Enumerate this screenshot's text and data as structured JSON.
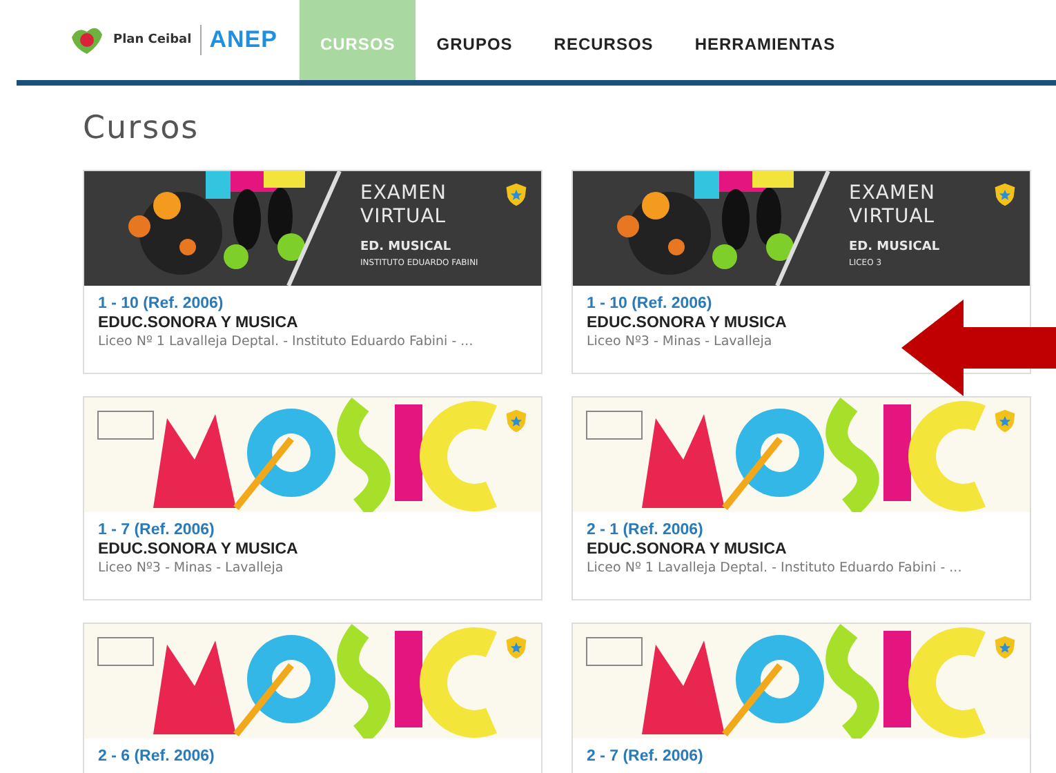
{
  "header": {
    "brand": "Plan Ceibal",
    "logo_text": "ANEP",
    "nav": [
      {
        "label": "CURSOS",
        "selected": true
      },
      {
        "label": "GRUPOS",
        "selected": false
      },
      {
        "label": "RECURSOS",
        "selected": false
      },
      {
        "label": "HERRAMIENTAS",
        "selected": false
      }
    ]
  },
  "page_title": "Cursos",
  "cards": [
    {
      "banner": {
        "kind": "exam",
        "heading": "EXAMEN VIRTUAL",
        "subject": "ED. MUSICAL",
        "school": "INSTITUTO EDUARDO FABINI"
      },
      "code": "1 - 10 (Ref. 2006)",
      "name": "EDUC.SONORA Y MUSICA",
      "place": "Liceo Nº 1 Lavalleja Deptal. - Instituto Eduardo Fabini - ..."
    },
    {
      "banner": {
        "kind": "exam",
        "heading": "EXAMEN VIRTUAL",
        "subject": "ED. MUSICAL",
        "school": "LICEO 3"
      },
      "code": "1 - 10 (Ref. 2006)",
      "name": "EDUC.SONORA Y MUSICA",
      "place": "Liceo Nº3 - Minas - Lavalleja"
    },
    {
      "banner": {
        "kind": "music"
      },
      "code": "1 - 7 (Ref. 2006)",
      "name": "EDUC.SONORA Y MUSICA",
      "place": "Liceo Nº3 - Minas - Lavalleja"
    },
    {
      "banner": {
        "kind": "music"
      },
      "code": "2 - 1 (Ref. 2006)",
      "name": "EDUC.SONORA Y MUSICA",
      "place": "Liceo Nº 1 Lavalleja Deptal. - Instituto Eduardo Fabini - ..."
    },
    {
      "banner": {
        "kind": "music"
      },
      "code": "2 - 6 (Ref. 2006)"
    },
    {
      "banner": {
        "kind": "music"
      },
      "code": "2 - 7 (Ref. 2006)"
    }
  ]
}
